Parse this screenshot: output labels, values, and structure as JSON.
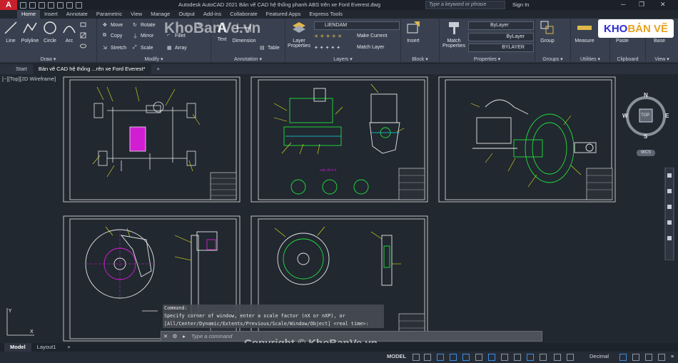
{
  "titlebar": {
    "app_logo": "A",
    "title": "Autodesk AutoCAD 2021    Bản vẽ CAD hệ thống phanh ABS trên xe Ford Everest.dwg",
    "search_placeholder": "Type a keyword or phrase",
    "signin": "Sign In"
  },
  "ribbon_tabs": [
    "Home",
    "Insert",
    "Annotate",
    "Parametric",
    "View",
    "Manage",
    "Output",
    "Add-ins",
    "Collaborate",
    "Featured Apps",
    "Express Tools"
  ],
  "draw": {
    "line": "Line",
    "polyline": "Polyline",
    "circle": "Circle",
    "arc": "Arc",
    "label": "Draw ▾"
  },
  "modify": {
    "move": "Move",
    "rotate": "Rotate",
    "copy": "Copy",
    "mirror": "Mirror",
    "fillet": "Fillet",
    "stretch": "Stretch",
    "scale": "Scale",
    "array": "Array",
    "label": "Modify ▾"
  },
  "annotation": {
    "text": "Text",
    "dimension": "Dimension",
    "table": "Table",
    "label": "Annotation ▾"
  },
  "layers": {
    "layer_properties": "Layer Properties",
    "current_layer": "LIENDAM",
    "make_current": "Make Current",
    "match_layer": "Match Layer",
    "label": "Layers ▾"
  },
  "block": {
    "insert": "Insert",
    "label": "Block ▾"
  },
  "properties": {
    "match_properties": "Match Properties",
    "color": "ByLayer",
    "linetype": "ByLayer",
    "lineweight": "BYLAYER",
    "label": "Properties ▾"
  },
  "groups": {
    "group": "Group",
    "label": "Groups ▾"
  },
  "utilities": {
    "measure": "Measure",
    "label": "Utilities ▾"
  },
  "clipboard": {
    "paste": "Paste",
    "label": "Clipboard"
  },
  "view_panel": {
    "base": "Base",
    "label": "View ▾"
  },
  "doc_tabs": {
    "start": "Start",
    "drawing": "Bản vẽ CAD hệ thống ...rên xe Ford Everest*"
  },
  "viewport_label": "[−][Top][2D Wireframe]",
  "navcube": {
    "n": "N",
    "s": "S",
    "e": "E",
    "w": "W",
    "top": "TOP",
    "wcs": "WCS"
  },
  "sheet_detail_label": "mặt cắt A-A",
  "command_history": [
    "Command:",
    "Specify corner of window, enter a scale factor (nX or nXP), or",
    "[All/Center/Dynamic/Extents/Previous/Scale/Window/Object] <real time>:"
  ],
  "command_placeholder": "Type a command",
  "layout_tabs": [
    "Model",
    "Layout1"
  ],
  "status": {
    "model": "MODEL",
    "units": "Decimal"
  },
  "watermark": {
    "logo_a": "KHO",
    "logo_b": "BẢN VẼ",
    "center": "KhoBanVe.vn",
    "bottom": "Copyright © KhoBanVe.vn"
  },
  "colors": {
    "accent_red": "#c8202c",
    "cad_green": "#22e03c",
    "cad_yellow": "#e6e619",
    "cad_magenta": "#d21ed2",
    "cad_cyan": "#19d2e6"
  }
}
